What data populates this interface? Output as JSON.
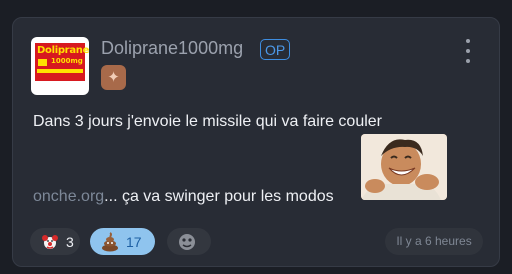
{
  "post": {
    "username": "Doliprane1000mg",
    "op_label": "OP",
    "avatar": {
      "brand": "Doliprane",
      "dose": "1000mg"
    },
    "rank_badge_icon": "star-rank-icon",
    "message": {
      "line1": "Dans 3 jours j'envoie le missile qui va faire couler",
      "link": "onche.org",
      "line2_rest": "... ça va swinger pour les modos"
    },
    "sticker_icon": "laughing-man-sticker",
    "reactions": [
      {
        "icon": "clown-icon",
        "count": "3"
      },
      {
        "icon": "poop-icon",
        "count": "17"
      },
      {
        "icon": "face-icon",
        "count": ""
      }
    ],
    "timestamp": "Il y a 6 heures"
  },
  "colors": {
    "background": "#1b1e25",
    "card": "#282c35",
    "accent_blue": "#3e8de0",
    "active_reaction": "#8fc4ee",
    "rank_bronze": "#a86a4a"
  }
}
